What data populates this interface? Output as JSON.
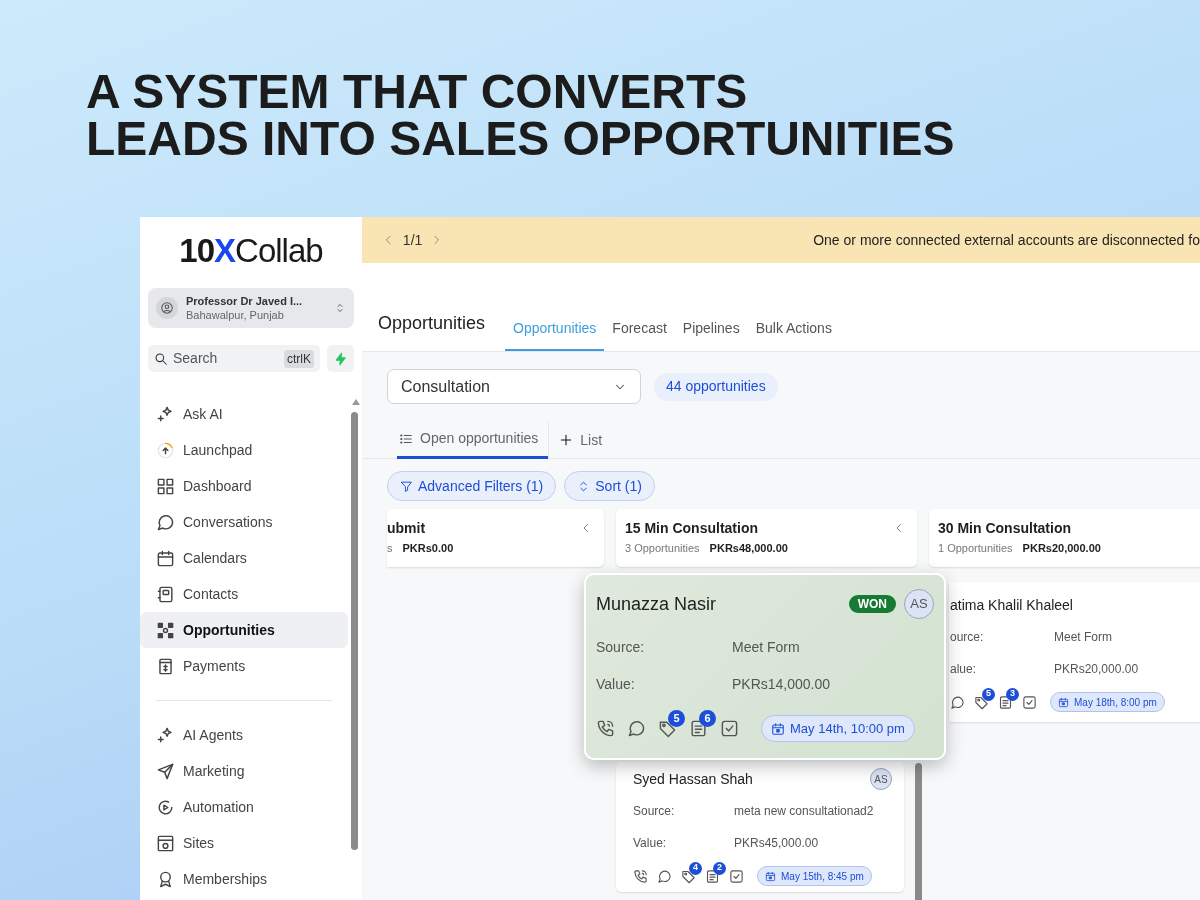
{
  "headline": [
    "A SYSTEM THAT CONVERTS",
    "LEADS INTO SALES OPPORTUNITIES"
  ],
  "sidebar": {
    "logo": {
      "mark": "10",
      "accent": "X",
      "name": "Collab"
    },
    "account": {
      "name": "Professor Dr Javed I...",
      "location": "Bahawalpur, Punjab"
    },
    "search": {
      "placeholder": "Search",
      "shortcut": "ctrlK"
    },
    "nav_groups": [
      {
        "items": [
          {
            "label": "Ask AI",
            "selected": false
          },
          {
            "label": "Launchpad",
            "selected": false
          },
          {
            "label": "Dashboard",
            "selected": false
          },
          {
            "label": "Conversations",
            "selected": false
          },
          {
            "label": "Calendars",
            "selected": false
          },
          {
            "label": "Contacts",
            "selected": false
          },
          {
            "label": "Opportunities",
            "selected": true
          },
          {
            "label": "Payments",
            "selected": false
          }
        ]
      },
      {
        "items": [
          {
            "label": "AI Agents",
            "selected": false
          },
          {
            "label": "Marketing",
            "selected": false
          },
          {
            "label": "Automation",
            "selected": false
          },
          {
            "label": "Sites",
            "selected": false
          },
          {
            "label": "Memberships",
            "selected": false
          }
        ]
      }
    ]
  },
  "banner": {
    "pager": "1/1",
    "message": "One or more connected external accounts are disconnected fo"
  },
  "header": {
    "title": "Opportunities",
    "tabs": [
      {
        "label": "Opportunities",
        "selected": true
      },
      {
        "label": "Forecast",
        "selected": false
      },
      {
        "label": "Pipelines",
        "selected": false
      },
      {
        "label": "Bulk Actions",
        "selected": false
      }
    ]
  },
  "pipeline_select": {
    "value": "Consultation"
  },
  "count_pill": "44 opportunities",
  "view_tabs": [
    {
      "kind": "list",
      "label": "Open opportunities",
      "selected": true
    },
    {
      "kind": "add",
      "label": "List",
      "selected": false
    }
  ],
  "filters": [
    {
      "kind": "filter",
      "label": "Advanced Filters (1)"
    },
    {
      "kind": "sort",
      "label": "Sort (1)"
    }
  ],
  "columns": [
    {
      "title": "ubmit",
      "count": "s",
      "total": "PKRs0.00",
      "chevron": true
    },
    {
      "title": "15 Min Consultation",
      "count": "3 Opportunities",
      "total": "PKRs48,000.00",
      "chevron": true,
      "cards": [
        {
          "name": "Munazza Nasir",
          "badge": "WON",
          "avatar": "AS",
          "dragging": true,
          "fields": [
            {
              "label": "Source:",
              "value": "Meet Form"
            },
            {
              "label": "Value:",
              "value": "PKRs14,000.00"
            }
          ],
          "actions": [
            {
              "kind": "phone"
            },
            {
              "kind": "chat"
            },
            {
              "kind": "tag",
              "count": "5"
            },
            {
              "kind": "note",
              "count": "6"
            },
            {
              "kind": "task"
            }
          ],
          "due": "May 14th, 10:00 pm"
        },
        {
          "name": "Syed Hassan Shah",
          "avatar": "AS",
          "dragging": false,
          "fields": [
            {
              "label": "Source:",
              "value": "meta new consultationad2"
            },
            {
              "label": "Value:",
              "value": "PKRs45,000.00"
            }
          ],
          "actions": [
            {
              "kind": "phone"
            },
            {
              "kind": "chat"
            },
            {
              "kind": "tag",
              "count": "4"
            },
            {
              "kind": "note",
              "count": "2"
            },
            {
              "kind": "task"
            }
          ],
          "due": "May 15th, 8:45 pm"
        }
      ]
    },
    {
      "title": "30 Min Consultation",
      "count": "1 Opportunities",
      "total": "PKRs20,000.00",
      "chevron": false,
      "cards": [
        {
          "name": "atima Khalil Khaleel",
          "dragging": false,
          "fields": [
            {
              "label": "ource:",
              "value": "Meet Form"
            },
            {
              "label": "alue:",
              "value": "PKRs20,000.00"
            }
          ],
          "actions": [
            {
              "kind": "chat"
            },
            {
              "kind": "tag",
              "count": "5"
            },
            {
              "kind": "note",
              "count": "3"
            },
            {
              "kind": "task"
            }
          ],
          "due": "May 18th, 8:00 pm"
        }
      ]
    }
  ]
}
